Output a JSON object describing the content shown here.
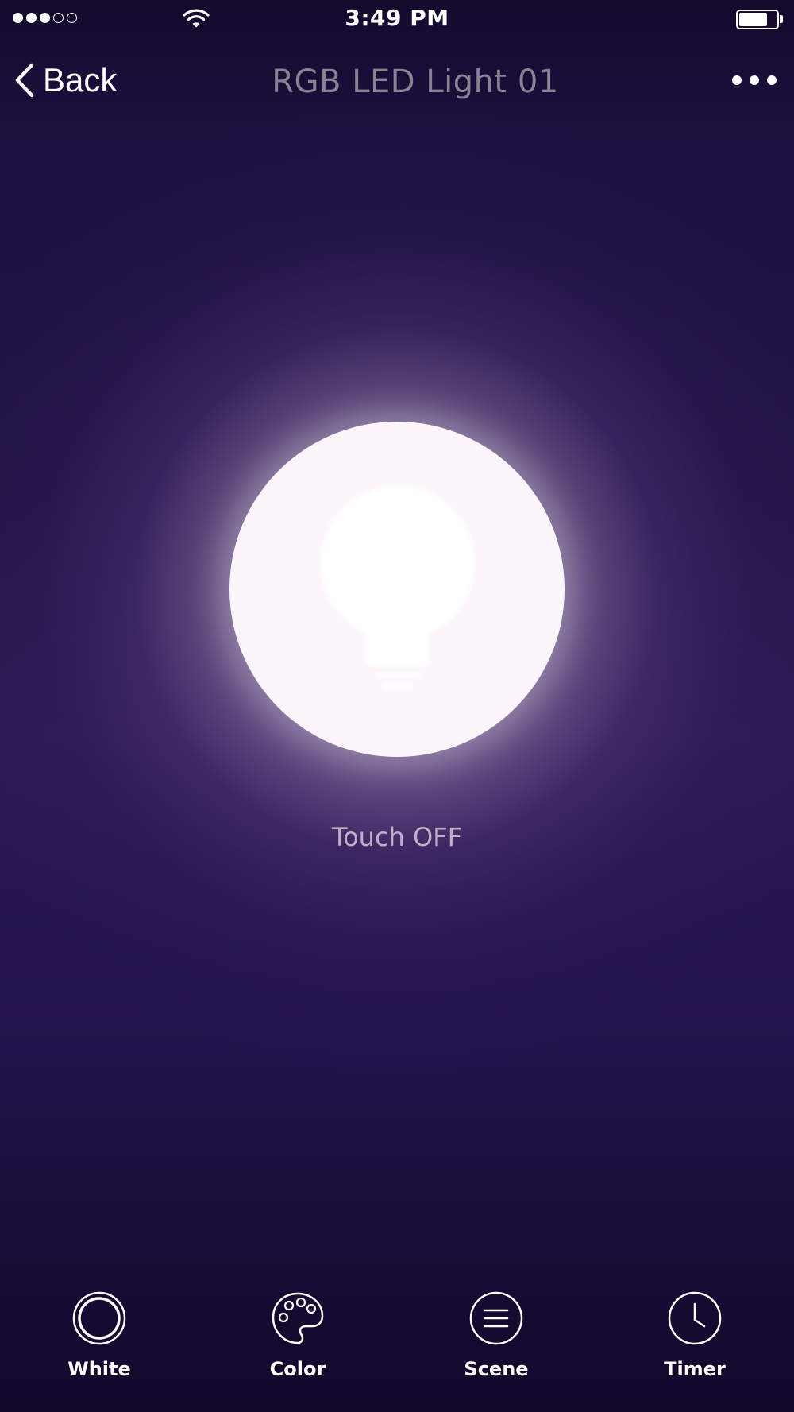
{
  "status_bar": {
    "time": "3:49 PM",
    "signal": {
      "filled": 3,
      "total": 5
    },
    "battery_level": 0.75,
    "icons": [
      "signal-dots-icon",
      "wifi-icon",
      "battery-icon"
    ]
  },
  "nav": {
    "back_label": "Back",
    "title": "RGB LED Light 01",
    "icons": [
      "chevron-left-icon",
      "more-dots-icon"
    ]
  },
  "main": {
    "power_icon": "lightbulb-icon",
    "touch_label": "Touch OFF"
  },
  "tabs": [
    {
      "label": "White",
      "icon": "white-ring-icon"
    },
    {
      "label": "Color",
      "icon": "palette-icon"
    },
    {
      "label": "Scene",
      "icon": "scene-lines-icon"
    },
    {
      "label": "Timer",
      "icon": "clock-icon"
    }
  ],
  "colors": {
    "background_dark": "#12082a",
    "background_mid": "#2c1a52",
    "button_fill": "#fcf6fc",
    "title_text": "#8b8193",
    "touch_text": "#bdb0c8",
    "icon_white": "#ffffff"
  }
}
